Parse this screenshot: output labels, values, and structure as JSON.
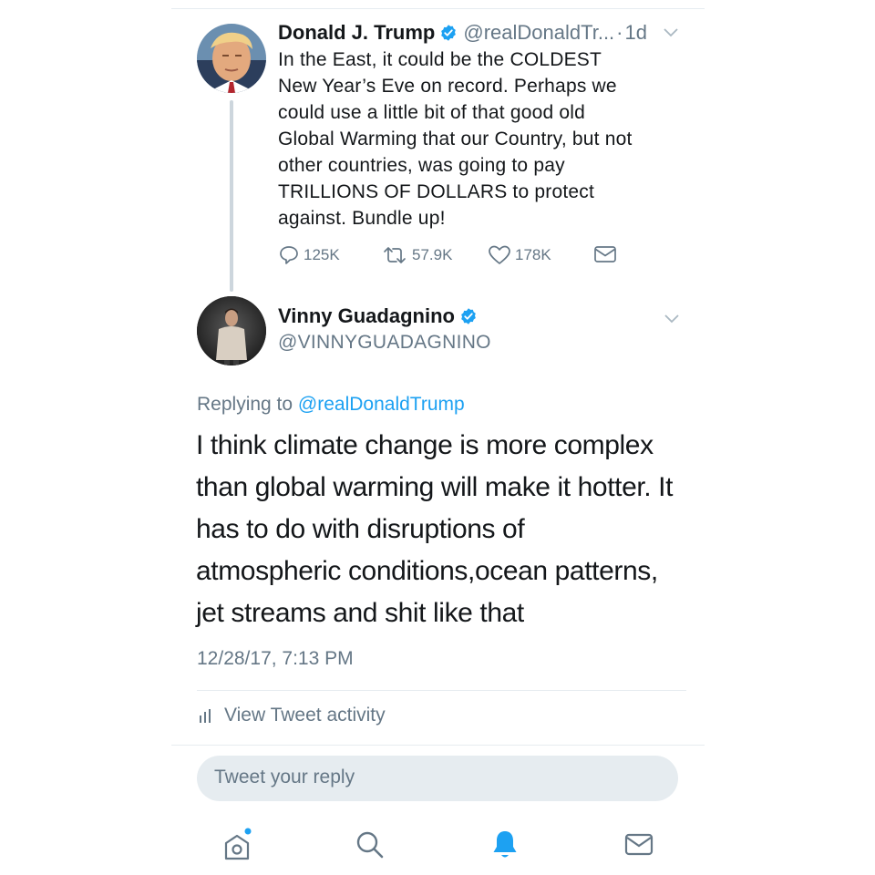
{
  "tweet1": {
    "name": "Donald J. Trump",
    "handle": "@realDonaldTr...",
    "separator": "·",
    "time": "1d",
    "text": "In the East, it could be the COLDEST\nNew Year’s Eve on record. Perhaps we\ncould use a little bit of that good old\nGlobal Warming that our Country, but not\nother countries, was going to pay\nTRILLIONS OF DOLLARS to protect\nagainst. Bundle up!",
    "replies": "125K",
    "retweets": "57.9K",
    "likes": "178K",
    "icons": {
      "reply": "speech-bubble-icon",
      "retweet": "retweet-icon",
      "like": "heart-icon",
      "dm": "envelope-icon"
    }
  },
  "tweet2": {
    "name": "Vinny Guadagnino",
    "handle": "@VINNYGUADAGNINO",
    "replying_prefix": "Replying to ",
    "replying_to": "@realDonaldTrump",
    "text": "I think climate change is more complex\nthan global warming will make it hotter. It\nhas to do with disruptions of\natmospheric conditions,ocean patterns,\njet streams and shit like that",
    "timestamp": "12/28/17, 7:13 PM"
  },
  "activity": {
    "label": "View Tweet activity"
  },
  "reply_box": {
    "placeholder": "Tweet your reply"
  },
  "tabbar": {
    "items": [
      "home-icon",
      "search-icon",
      "notifications-bell-icon",
      "messages-envelope-icon"
    ],
    "active": "notifications-bell-icon"
  },
  "colors": {
    "accent": "#1da1f2",
    "muted": "#657786",
    "text": "#14171a",
    "divider": "#e6ecf0"
  }
}
